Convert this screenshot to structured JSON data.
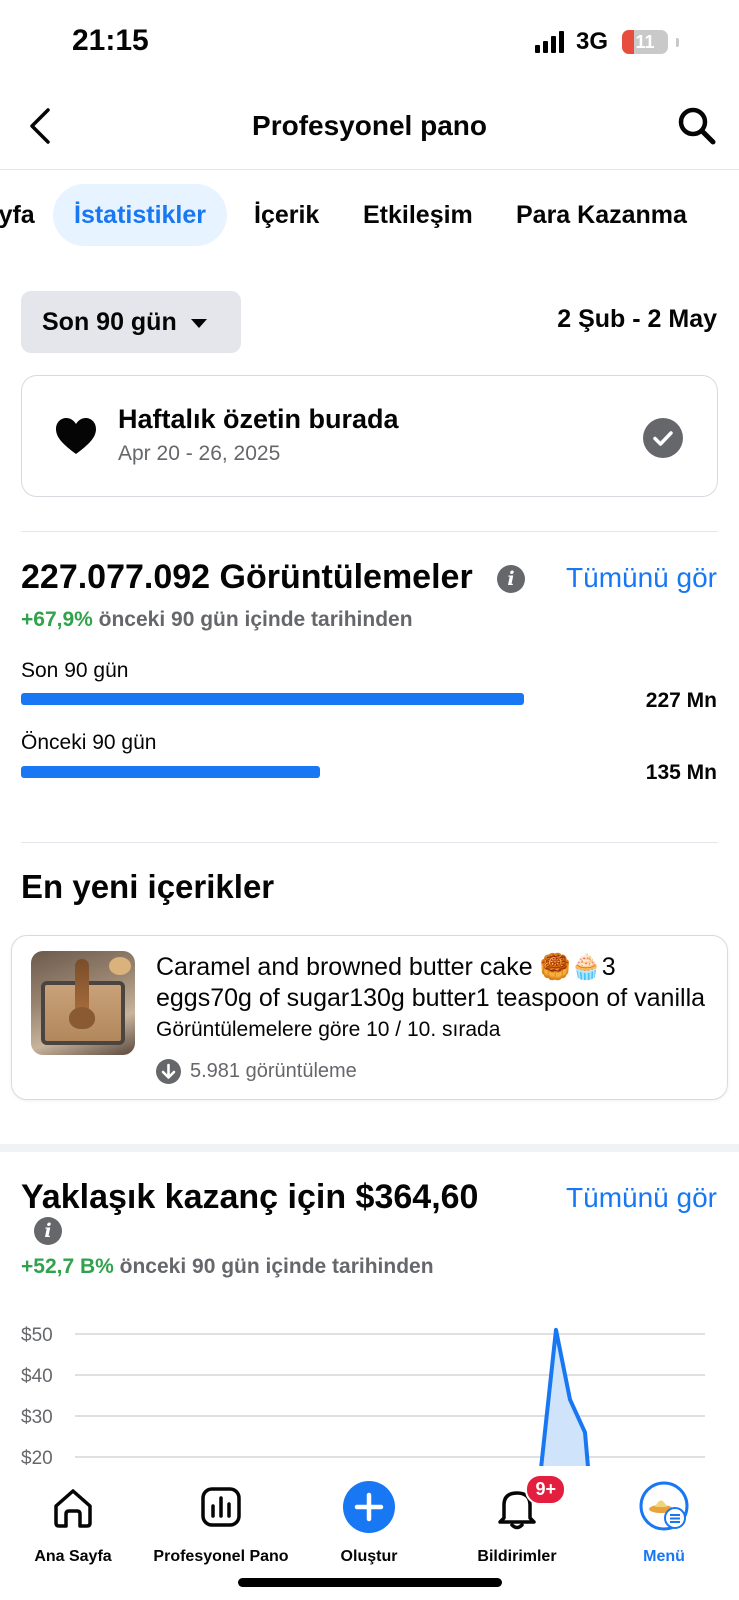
{
  "status_bar": {
    "time": "21:15",
    "network": "3G",
    "battery": "11"
  },
  "header": {
    "title": "Profesyonel pano"
  },
  "tabs": [
    {
      "label": "Sayfa",
      "active": false
    },
    {
      "label": "İstatistikler",
      "active": true
    },
    {
      "label": "İçerik",
      "active": false
    },
    {
      "label": "Etkileşim",
      "active": false
    },
    {
      "label": "Para Kazanma",
      "active": false
    }
  ],
  "filter": {
    "range_label": "Son 90 gün",
    "date_range": "2 Şub - 2 May"
  },
  "weekly": {
    "title": "Haftalık özetin burada",
    "subtitle": "Apr 20 - 26, 2025"
  },
  "views": {
    "title": "227.077.092 Görüntülemeler",
    "see_all": "Tümünü gör",
    "delta": "+67,9%",
    "delta_text": "önceki 90 gün içinde tarihinden",
    "bars": [
      {
        "label": "Son 90 gün",
        "value": 227,
        "value_text": "227 Mn"
      },
      {
        "label": "Önceki 90 gün",
        "value": 135,
        "value_text": "135 Mn"
      }
    ]
  },
  "newest": {
    "heading": "En yeni içerikler",
    "item": {
      "title": "Caramel and browned butter cake 🥮🧁3 eggs70g of sugar130g butter1 teaspoon of vanilla",
      "rank": "Görüntülemelere göre 10 / 10. sırada",
      "views": "5.981 görüntüleme"
    }
  },
  "earnings": {
    "title": "Yaklaşık kazanç için $364,60",
    "see_all": "Tümünü gör",
    "delta": "+52,7 B%",
    "delta_text": "önceki 90 gün içinde tarihinden"
  },
  "chart_data": {
    "type": "area",
    "y_ticks": [
      "$50",
      "$40",
      "$30",
      "$20"
    ],
    "ylim": [
      20,
      50
    ],
    "x": [
      0,
      1,
      2,
      3,
      4,
      5,
      6,
      7
    ],
    "values": [
      15,
      51,
      34,
      26,
      12,
      12,
      12,
      12
    ],
    "color": "#1877f2"
  },
  "bottom_nav": [
    {
      "label": "Ana Sayfa",
      "icon": "home-icon",
      "active": false
    },
    {
      "label": "Profesyonel Pano",
      "icon": "dashboard-icon",
      "active": false
    },
    {
      "label": "Oluştur",
      "icon": "plus-icon",
      "active": false
    },
    {
      "label": "Bildirimler",
      "icon": "bell-icon",
      "active": false,
      "badge": "9+"
    },
    {
      "label": "Menü",
      "icon": "profile-menu-icon",
      "active": true
    }
  ],
  "colors": {
    "accent": "#1877f2",
    "positive": "#31a24c",
    "muted": "#65676b",
    "badge": "#e41e3f"
  }
}
